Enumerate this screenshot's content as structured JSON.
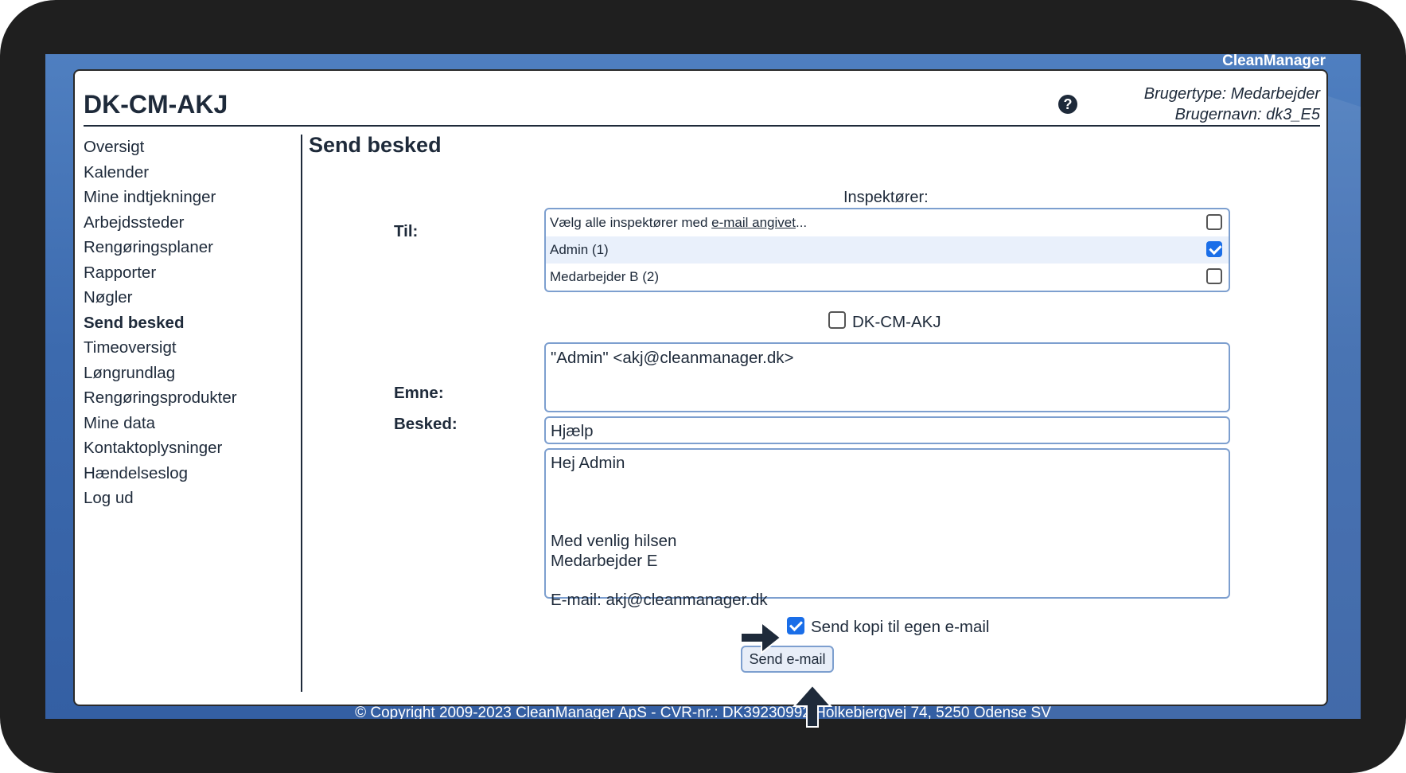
{
  "brand": "CleanManager",
  "site_title": "DK-CM-AKJ",
  "user": {
    "type_line": "Brugertype: Medarbejder",
    "name_line": "Brugernavn: dk3_E5"
  },
  "nav": [
    {
      "label": "Oversigt",
      "active": false
    },
    {
      "label": "Kalender",
      "active": false
    },
    {
      "label": "Mine indtjekninger",
      "active": false
    },
    {
      "label": "Arbejdssteder",
      "active": false
    },
    {
      "label": "Rengøringsplaner",
      "active": false
    },
    {
      "label": "Rapporter",
      "active": false
    },
    {
      "label": "Nøgler",
      "active": false
    },
    {
      "label": "Send besked",
      "active": true
    },
    {
      "label": "Timeoversigt",
      "active": false
    },
    {
      "label": "Løngrundlag",
      "active": false
    },
    {
      "label": "Rengøringsprodukter",
      "active": false
    },
    {
      "label": "Mine data",
      "active": false
    },
    {
      "label": "Kontaktoplysninger",
      "active": false
    },
    {
      "label": "Hændelseslog",
      "active": false
    },
    {
      "label": "Log ud",
      "active": false
    }
  ],
  "page": {
    "heading": "Send besked",
    "to_label": "Til:",
    "inspectors_label": "Inspektører:",
    "select_all_prefix": "Vælg alle inspektører med ",
    "select_all_link": "e-mail angivet",
    "select_all_suffix": "...",
    "inspectors": [
      {
        "label": "Admin (1)",
        "checked": true
      },
      {
        "label": "Medarbejder B (2)",
        "checked": false
      }
    ],
    "group_checkbox_label": "DK-CM-AKJ",
    "recipients_value": "\"Admin\" <akj@cleanmanager.dk>",
    "subject_label": "Emne:",
    "subject_value": "Hjælp",
    "message_label": "Besked:",
    "message_value": "Hej Admin\n\n\n\nMed venlig hilsen\nMedarbejder E\n\nE-mail: akj@cleanmanager.dk",
    "copy_label": "Send kopi til egen e-mail",
    "send_button": "Send e-mail"
  },
  "footer": "© Copyright 2009-2023 CleanManager ApS - CVR-nr.: DK39230992 Holkebjergvej 74, 5250 Odense SV",
  "colors": {
    "accent": "#1a6ee8",
    "text": "#1e2a3a",
    "border": "#7d9fcf",
    "background": "#3c6aae"
  }
}
